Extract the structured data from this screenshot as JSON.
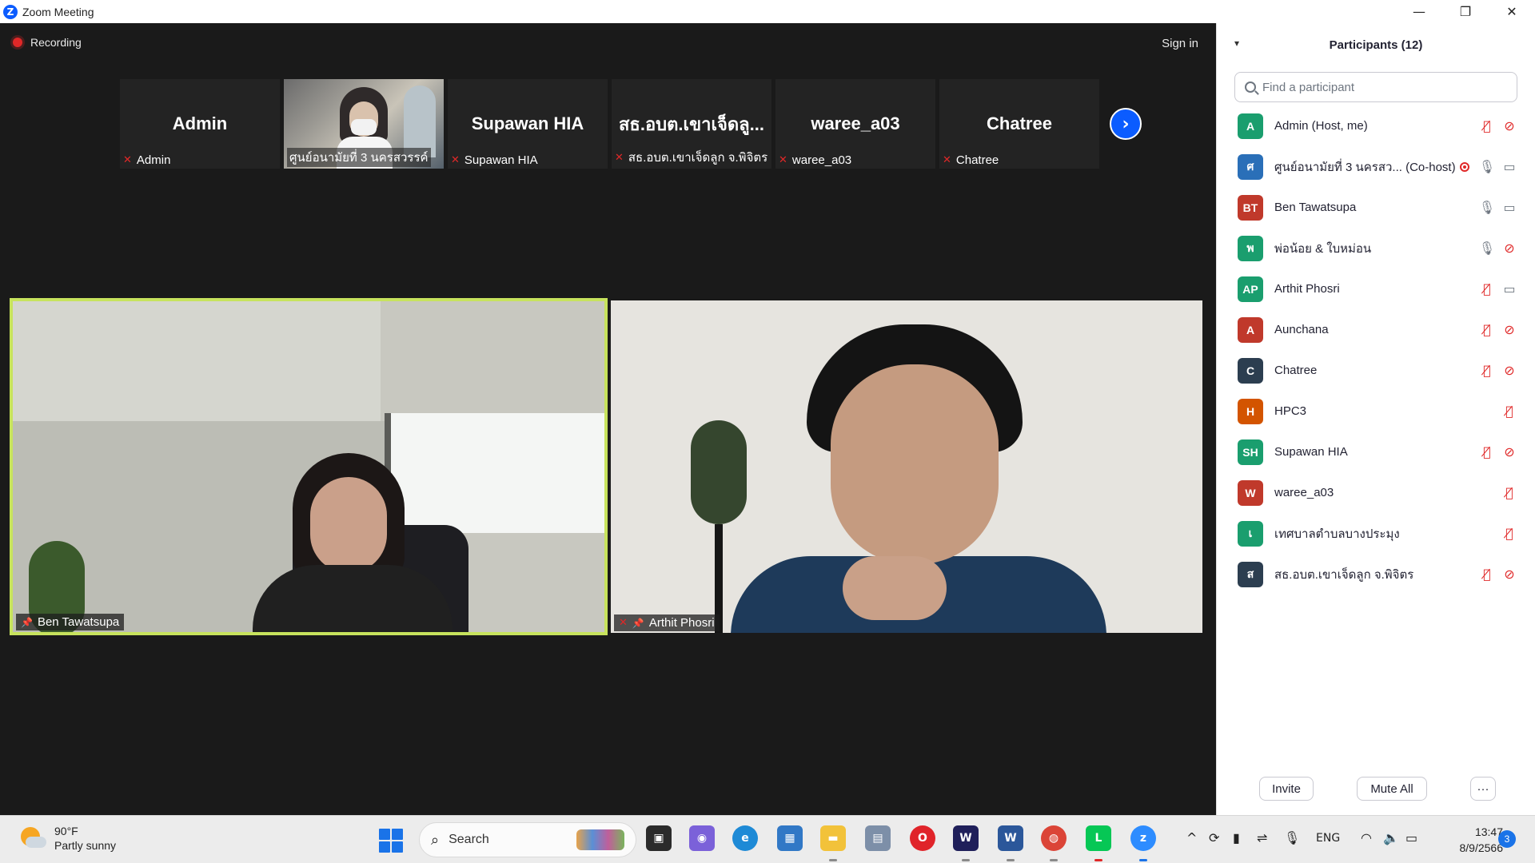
{
  "window": {
    "title": "Zoom Meeting",
    "controls": {
      "minimize": "—",
      "restore": "❐",
      "close": "✕"
    }
  },
  "meeting": {
    "recording_label": "Recording",
    "signin_label": "Sign in",
    "thumbnails": [
      {
        "display": "Admin",
        "label": "Admin",
        "has_video": false
      },
      {
        "display": "",
        "label": "ศูนย์อนามัยที่ 3 นครสวรรค์",
        "has_video": true
      },
      {
        "display": "Supawan HIA",
        "label": "Supawan HIA",
        "has_video": false
      },
      {
        "display": "สธ.อบต.เขาเจ็ดลู...",
        "label": "สธ.อบต.เขาเจ็ดลูก จ.พิจิตร",
        "has_video": false
      },
      {
        "display": "waree_a03",
        "label": "waree_a03",
        "has_video": false
      },
      {
        "display": "Chatree",
        "label": "Chatree",
        "has_video": false
      }
    ],
    "next_icon": "chevron-right-icon",
    "videos": [
      {
        "name": "Ben Tawatsupa",
        "pinned": true,
        "active_speaker": true
      },
      {
        "name": "Arthit Phosri",
        "pinned": true,
        "muted": true
      }
    ]
  },
  "participants": {
    "title": "Participants (12)",
    "search_placeholder": "Find a participant",
    "items": [
      {
        "initials": "A",
        "name": "Admin (Host, me)",
        "color": "#1a9e6e",
        "mic": "off",
        "video": "off"
      },
      {
        "initials": "ศ",
        "name": "ศูนย์อนามัยที่ 3 นครสว...  (Co-host)",
        "color": "#2a6fb8",
        "mic": "on",
        "video": "on",
        "recording": true
      },
      {
        "initials": "BT",
        "name": "Ben Tawatsupa",
        "color": "#c0392b",
        "mic": "on",
        "video": "on"
      },
      {
        "initials": "พ",
        "name": "พ่อน้อย & ใบหม่อน",
        "color": "#1a9e6e",
        "mic": "on",
        "video": "off"
      },
      {
        "initials": "AP",
        "name": "Arthit Phosri",
        "color": "#1a9e6e",
        "mic": "off",
        "video": "on"
      },
      {
        "initials": "A",
        "name": "Aunchana",
        "color": "#c0392b",
        "mic": "off",
        "video": "off"
      },
      {
        "initials": "C",
        "name": "Chatree",
        "color": "#2c3e50",
        "mic": "off",
        "video": "off"
      },
      {
        "initials": "H",
        "name": "HPC3",
        "color": "#d35400",
        "mic": "off",
        "video": "none"
      },
      {
        "initials": "SH",
        "name": "Supawan HIA",
        "color": "#1a9e6e",
        "mic": "off",
        "video": "off"
      },
      {
        "initials": "W",
        "name": "waree_a03",
        "color": "#c0392b",
        "mic": "off",
        "video": "none"
      },
      {
        "initials": "เ",
        "name": "เทศบาลตำบลบางประมุง",
        "color": "#1a9e6e",
        "mic": "off",
        "video": "none"
      },
      {
        "initials": "ส",
        "name": "สธ.อบต.เขาเจ็ดลูก จ.พิจิตร",
        "color": "#2c3e50",
        "mic": "off",
        "video": "off"
      }
    ],
    "buttons": {
      "invite": "Invite",
      "mute_all": "Mute All",
      "more": "···"
    }
  },
  "taskbar": {
    "weather": {
      "temp": "90°F",
      "desc": "Partly sunny"
    },
    "search_label": "Search",
    "lang": "ENG",
    "time": "13:47",
    "date": "8/9/2566",
    "notifications": "3",
    "apps": [
      "task-view-icon",
      "chat-icon",
      "edge-icon",
      "store-icon",
      "file-explorer-icon",
      "photos-icon",
      "opera-icon",
      "webex-icon",
      "word-icon",
      "chrome-icon",
      "line-icon",
      "zoom-icon"
    ]
  }
}
